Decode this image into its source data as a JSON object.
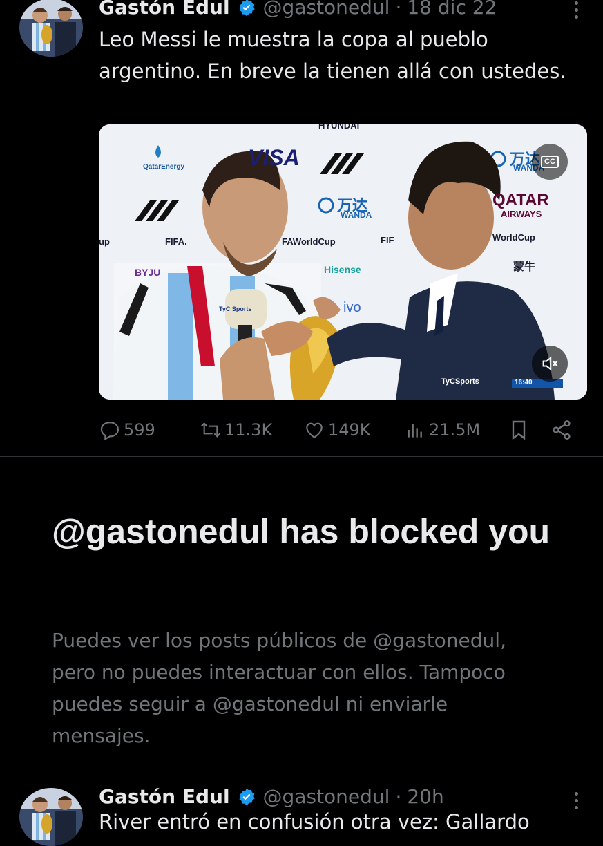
{
  "tweet1": {
    "display_name": "Gastón Edul",
    "handle": "@gastonedul",
    "separator": "·",
    "time": "18 dic 22",
    "text": "Leo Messi le muestra la copa al pueblo argentino. En breve la tienen allá con ustedes.",
    "media": {
      "sponsors": {
        "hyundai": "HYUNDAI",
        "visa": "VISA",
        "wanda_cn": "万达",
        "wanda": "WANDA",
        "wanda_cn_right": "万达",
        "wanda_right": "WANDA",
        "qatar": "QATAR",
        "airways": "AIRWAYS",
        "worldcup_right": "WorldCup",
        "worldcup_center": "FAWorldCup",
        "fifa_left": "FIFA.",
        "fifa_mid": "FIF",
        "up": "up",
        "hisense": "Hisense",
        "vivo": "ivo",
        "byju": "BYJU",
        "qatarenergy": "QatarEnergy",
        "mengniu": "蒙牛"
      },
      "mic_label": "TyC Sports",
      "watermark": "TyCSports",
      "clock": "16:40",
      "cc_label": "CC"
    },
    "stats": {
      "replies": "599",
      "reposts": "11.3K",
      "likes": "149K",
      "views": "21.5M"
    }
  },
  "blocked": {
    "title": "@gastonedul has blocked you",
    "description": "Puedes ver los posts públicos de @gastonedul, pero no puedes interactuar con ellos. Tampoco puedes seguir a @gastonedul ni enviarle mensajes."
  },
  "tweet2": {
    "display_name": "Gastón Edul",
    "handle": "@gastonedul",
    "separator": "·",
    "time": "20h",
    "text": "River entró en confusión otra vez: Gallardo"
  },
  "colors": {
    "background": "#000000",
    "text": "#e7e9ea",
    "muted": "#71767b",
    "verified": "#1d9bf0",
    "divider": "#2f3336"
  },
  "icons": [
    "verified-badge-icon",
    "more-icon",
    "reply-icon",
    "repost-icon",
    "like-icon",
    "views-icon",
    "bookmark-icon",
    "share-icon",
    "cc-icon",
    "mute-icon"
  ]
}
